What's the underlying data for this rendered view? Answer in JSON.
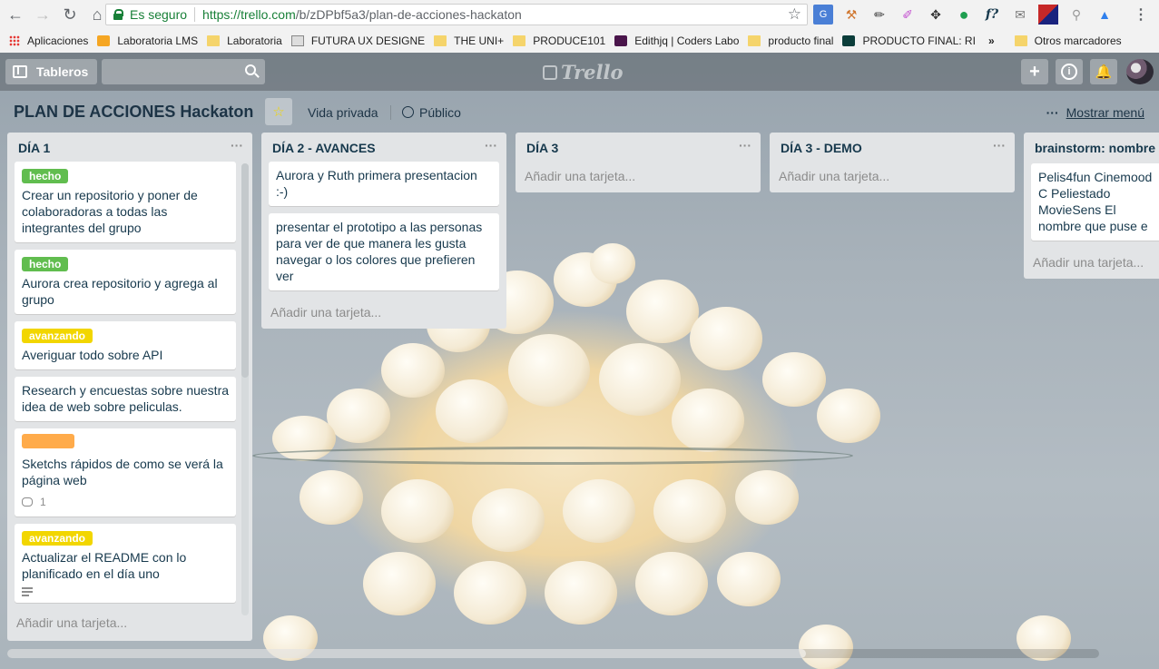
{
  "browser": {
    "secure_label": "Es seguro",
    "url_host": "https://trello.com",
    "url_path": "/b/zDPbf5a3/plan-de-acciones-hackaton",
    "bookmarks": [
      {
        "label": "Aplicaciones",
        "icon": "apps-icon"
      },
      {
        "label": "Laboratoria LMS",
        "icon": "lms-icon"
      },
      {
        "label": "Laboratoria",
        "icon": "folder-icon"
      },
      {
        "label": "FUTURA UX DESIGNE",
        "icon": "page-icon"
      },
      {
        "label": "THE UNI+",
        "icon": "folder-icon"
      },
      {
        "label": "PRODUCE101",
        "icon": "folder-icon"
      },
      {
        "label": "Edithjq | Coders Labo",
        "icon": "slack-icon"
      },
      {
        "label": "producto final",
        "icon": "folder-icon"
      },
      {
        "label": "PRODUCTO FINAL: RI",
        "icon": "trello-icon"
      }
    ],
    "more_bookmarks": "»",
    "other_bookmarks": "Otros marcadores"
  },
  "topbar": {
    "boards_label": "Tableros",
    "logo_text": "Trello",
    "add_icon": "+",
    "info_icon": "i",
    "bell_icon": "bell"
  },
  "board": {
    "title": "PLAN DE ACCIONES Hackaton",
    "visibility_team": "Vida privada",
    "visibility_public": "Público",
    "menu_label": "Mostrar menú",
    "add_card_label": "Añadir una tarjeta..."
  },
  "colors": {
    "label_green": "#61bd4f",
    "label_yellow": "#f2d600",
    "label_orange": "#ffab4a"
  },
  "lists": [
    {
      "title": "DÍA 1",
      "cards": [
        {
          "label": "hecho",
          "label_color": "green",
          "text": "Crear un repositorio y poner de colaboradoras a todas las integrantes del grupo"
        },
        {
          "label": "hecho",
          "label_color": "green",
          "text": "Aurora crea repositorio y agrega al grupo"
        },
        {
          "label": "avanzando",
          "label_color": "yellow",
          "text": "Averiguar todo sobre API"
        },
        {
          "label": "",
          "label_color": "",
          "text": "Research y encuestas sobre nuestra idea de web sobre peliculas."
        },
        {
          "label": "",
          "label_color": "orange",
          "text": "Sketchs rápidos de como se verá la página web",
          "comments": "1"
        },
        {
          "label": "avanzando",
          "label_color": "yellow",
          "text": "Actualizar el README con lo planificado en el día uno",
          "has_description": true
        }
      ]
    },
    {
      "title": "DÍA 2 - AVANCES",
      "cards": [
        {
          "label": "",
          "label_color": "",
          "text": "Aurora y Ruth primera presentacion :-)"
        },
        {
          "label": "",
          "label_color": "",
          "text": "presentar el prototipo a las personas para ver de que manera les gusta navegar o los colores que prefieren ver"
        }
      ]
    },
    {
      "title": "DÍA 3",
      "cards": []
    },
    {
      "title": "DÍA 3 - DEMO",
      "cards": []
    },
    {
      "title": "brainstorm: nombre de pagina",
      "cards": [
        {
          "label": "",
          "label_color": "",
          "text": "Pelis4fun Cinemood C Peliestado MovieSens El nombre que puse e"
        }
      ]
    }
  ]
}
